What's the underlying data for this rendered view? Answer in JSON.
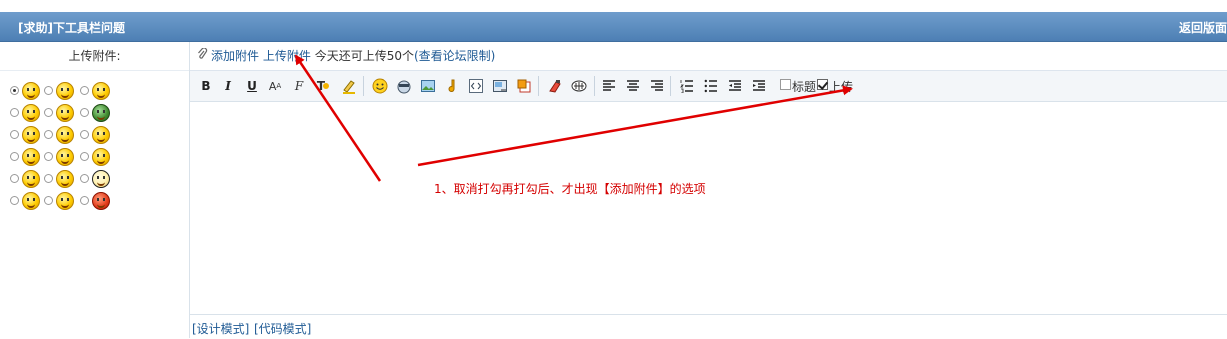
{
  "header": {
    "title": "[求助]下工具栏问题",
    "back_label": "返回版面"
  },
  "attachments": {
    "label": "上传附件:",
    "add_link": "添加附件",
    "upload_link": "上传附件",
    "quota_text": "今天还可上传50个",
    "limit_link": "(查看论坛限制)"
  },
  "toolbar": {
    "items": [
      "bold-icon",
      "italic-icon",
      "underline-icon",
      "font-face-icon",
      "font-size-icon",
      "text-color-icon",
      "highlight-icon",
      "emoticon-icon",
      "image-icon",
      "media-icon",
      "flash-icon",
      "code-icon",
      "link-icon",
      "table-icon",
      "clear-format-icon",
      "quote-icon",
      "align-left-icon",
      "align-center-icon",
      "align-right-icon",
      "ordered-list-icon",
      "unordered-list-icon",
      "outdent-icon",
      "indent-icon"
    ],
    "title_check_label": "标题",
    "upload_check_label": "上传"
  },
  "modes": {
    "design": "[设计模式]",
    "code": "[代码模式]"
  },
  "annotation": {
    "text": "1、取消打勾再打勾后、才出现【添加附件】的选项",
    "color": "#d40000"
  },
  "colors": {
    "titlebar": "#5a8ac0",
    "link": "#1f5a94",
    "annotation": "#d40000"
  }
}
